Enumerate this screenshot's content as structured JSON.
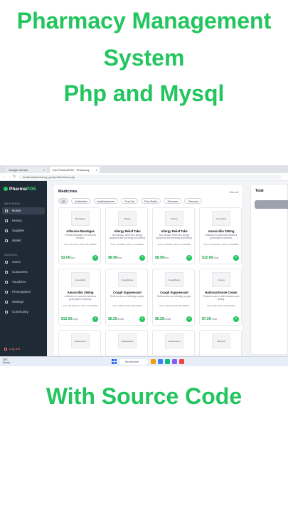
{
  "headline": {
    "line1": "Pharmacy Management",
    "line2": "System",
    "line3": "Php and Mysql"
  },
  "footer_title": "With Source Code",
  "browser": {
    "tabs": [
      {
        "label": "Google Gemini"
      },
      {
        "label": "Kivi PharmaPOS - Pharmacy"
      }
    ],
    "url": "localhost/pharmacy_pos/public/index.php"
  },
  "sidebar": {
    "brand_prefix": "Pharma",
    "brand_suffix": "POS",
    "main_menu_label": "MAIN MENU",
    "general_label": "GENERAL",
    "main_items": [
      {
        "label": "Home"
      },
      {
        "label": "History"
      },
      {
        "label": "Supplies"
      },
      {
        "label": "Wallet"
      }
    ],
    "general_items": [
      {
        "label": "Users"
      },
      {
        "label": "Customers"
      },
      {
        "label": "Vouchers"
      },
      {
        "label": "Prescriptions"
      },
      {
        "label": "Settings"
      },
      {
        "label": "Community"
      }
    ],
    "logout_label": "Log out"
  },
  "medicines": {
    "title": "Medicines",
    "see_all": "See all",
    "categories": [
      "All",
      "Antibiotics",
      "Antihistamines",
      "First Aid",
      "Pain Relief",
      "Skincare",
      "Vitamins"
    ],
    "cards": [
      {
        "thumb": "Bandages",
        "name": "Adhesive Bandages",
        "desc": "Flexible bandages for cuts and scrapes.",
        "meta": "Items: 36 boxes | Stock: 18 Available",
        "price": "$3.00",
        "unit": "/Box"
      },
      {
        "thumb": "Allergy",
        "name": "Allergy Relief Tabs",
        "desc": "Non-drowsy relief from allergy symptoms like sneezing and itching.",
        "meta": "Items: 20 tablets | Stock: 30 Available",
        "price": "$8.99",
        "unit": "/Box"
      },
      {
        "thumb": "Allergy",
        "name": "Allergy Relief Tabs",
        "desc": "Non-drowsy relief from allergy symptoms like sneezing and itching.",
        "meta": "Items: 20 tablets | Stock: 30 Available",
        "price": "$8.99",
        "unit": "/Box"
      },
      {
        "thumb": "Amoxicillin",
        "name": "Amoxicillin 250mg",
        "desc": "Antibiotic for bacterial infections (prescription required).",
        "meta": "Items: 30 capsules | Stock: 15 Available",
        "price": "$12.00",
        "unit": "/Strip"
      },
      {
        "thumb": "Amoxicillin",
        "name": "Amoxicillin 250mg",
        "desc": "Antibiotic for bacterial infections (prescription required).",
        "meta": "Items: 30 capsules | Stock: 22 Available",
        "price": "$12.00",
        "unit": "/Strip"
      },
      {
        "thumb": "CoughSyrup",
        "name": "Cough Suppressant",
        "desc": "Relieves dry and irritating coughs.",
        "meta": "Items: 100ml | Stock: 35 Available",
        "price": "$6.20",
        "unit": "/Bottle"
      },
      {
        "thumb": "CoughSyrup",
        "name": "Cough Suppressant",
        "desc": "Relieves dry and irritating coughs.",
        "meta": "Items: 100ml | Stock: 35 Available",
        "price": "$6.20",
        "unit": "/Bottle"
      },
      {
        "thumb": "Cream",
        "name": "Hydrocortisone Cream",
        "desc": "Topical cream for skin irritations and itching.",
        "meta": "Items: 30g | Stock: 50 Available",
        "price": "$7.50",
        "unit": "/Tube"
      },
      {
        "thumb": "Paracetamol",
        "name": "",
        "desc": "",
        "meta": "",
        "price": "",
        "unit": ""
      },
      {
        "thumb": "Paracetamol",
        "name": "",
        "desc": "",
        "meta": "",
        "price": "",
        "unit": ""
      },
      {
        "thumb": "Paracetamol",
        "name": "",
        "desc": "",
        "meta": "",
        "price": "",
        "unit": ""
      },
      {
        "thumb": "VitaminC",
        "name": "",
        "desc": "",
        "meta": "",
        "price": "",
        "unit": ""
      }
    ]
  },
  "order_panel": {
    "total_label": "Total"
  },
  "taskbar": {
    "weather_temp": "28°C",
    "weather_desc": "Sunny",
    "search_placeholder": "Rechercher"
  },
  "colors": {
    "accent": "#22c55e",
    "sidebar_bg": "#1f2a37",
    "price": "#16a34a"
  }
}
